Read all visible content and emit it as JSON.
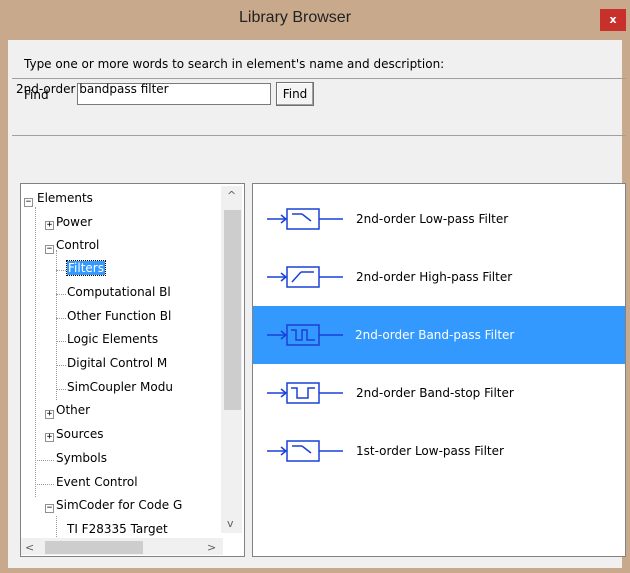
{
  "window": {
    "title": "Library Browser",
    "close_label": "x"
  },
  "search": {
    "prompt": "Type one or more words to search in element's name and  description:",
    "find_label": "Find",
    "value": "",
    "button_label": "Find"
  },
  "description": "2nd-order bandpass filter",
  "tree": {
    "elements": "Elements",
    "power": "Power",
    "control": "Control",
    "filters": "Filters",
    "computational": "Computational Bl",
    "other_function": "Other Function Bl",
    "logic": "Logic Elements",
    "digital": "Digital Control M",
    "simcoupler": "SimCoupler Modu",
    "other": "Other",
    "sources": "Sources",
    "symbols": "Symbols",
    "event_control": "Event Control",
    "simcoder": "SimCoder for Code G",
    "ti": "TI F28335 Target"
  },
  "elements": [
    {
      "label": "2nd-order Low-pass Filter",
      "icon": "lowpass-filter-icon",
      "selected": false
    },
    {
      "label": "2nd-order High-pass Filter",
      "icon": "highpass-filter-icon",
      "selected": false
    },
    {
      "label": "2nd-order Band-pass Filter",
      "icon": "bandpass-filter-icon",
      "selected": true
    },
    {
      "label": "2nd-order Band-stop Filter",
      "icon": "bandstop-filter-icon",
      "selected": false
    },
    {
      "label": "1st-order Low-pass Filter",
      "icon": "lowpass-filter-icon",
      "selected": false
    }
  ],
  "colors": {
    "title_bar": "#c9a98c",
    "selection": "#3399ff",
    "close": "#c7302b",
    "icon_stroke": "#1a40d8"
  }
}
